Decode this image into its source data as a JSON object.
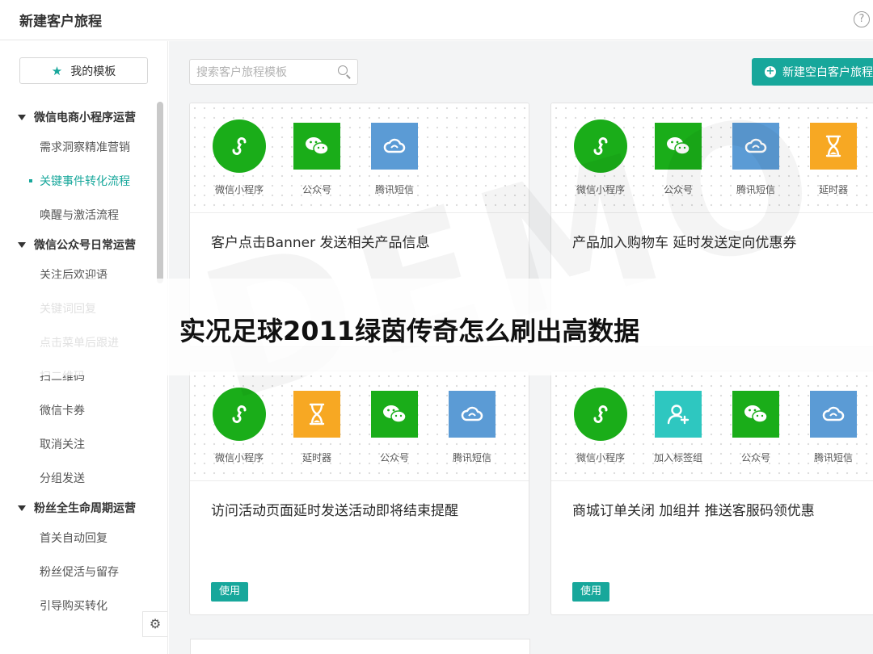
{
  "header": {
    "title": "新建客户旅程",
    "help_glyph": "?"
  },
  "sidebar": {
    "favorite_label": "我的模板",
    "settings_glyph": "⚙",
    "groups": [
      {
        "label": "微信电商小程序运营",
        "items": [
          "需求洞察精准营销",
          "关键事件转化流程",
          "唤醒与激活流程"
        ]
      },
      {
        "label": "微信公众号日常运营",
        "items": [
          "关注后欢迎语",
          "关键词回复",
          "点击菜单后跟进",
          "扫二维码",
          "微信卡券",
          "取消关注",
          "分组发送"
        ]
      },
      {
        "label": "粉丝全生命周期运营",
        "items": [
          "首关自动回复",
          "粉丝促活与留存",
          "引导购买转化"
        ]
      }
    ],
    "active_item": "关键事件转化流程"
  },
  "main": {
    "search_placeholder": "搜索客户旅程模板",
    "new_button_label": "新建空白客户旅程",
    "cards": [
      {
        "title": "客户点击Banner 发送相关产品信息",
        "use_label": "",
        "nodes": [
          {
            "label": "微信小程序",
            "icon": "mini-program-icon",
            "color": "#1aad19"
          },
          {
            "label": "公众号",
            "icon": "wechat-icon",
            "color": "#1aad19"
          },
          {
            "label": "腾讯短信",
            "icon": "cloud-sms-icon",
            "color": "#5b9bd5"
          }
        ]
      },
      {
        "title": "产品加入购物车 延时发送定向优惠券",
        "use_label": "",
        "nodes": [
          {
            "label": "微信小程序",
            "icon": "mini-program-icon",
            "color": "#1aad19"
          },
          {
            "label": "公众号",
            "icon": "wechat-icon",
            "color": "#1aad19"
          },
          {
            "label": "腾讯短信",
            "icon": "cloud-sms-icon",
            "color": "#5b9bd5"
          },
          {
            "label": "延时器",
            "icon": "hourglass-icon",
            "color": "#f7a823"
          }
        ]
      },
      {
        "title": "访问活动页面延时发送活动即将结束提醒",
        "use_label": "使用",
        "nodes": [
          {
            "label": "微信小程序",
            "icon": "mini-program-icon",
            "color": "#1aad19"
          },
          {
            "label": "延时器",
            "icon": "hourglass-icon",
            "color": "#f7a823"
          },
          {
            "label": "公众号",
            "icon": "wechat-icon",
            "color": "#1aad19"
          },
          {
            "label": "腾讯短信",
            "icon": "cloud-sms-icon",
            "color": "#5b9bd5"
          }
        ]
      },
      {
        "title": "商城订单关闭 加组并 推送客服码领优惠",
        "use_label": "使用",
        "nodes": [
          {
            "label": "微信小程序",
            "icon": "mini-program-icon",
            "color": "#1aad19"
          },
          {
            "label": "加入标签组",
            "icon": "add-user-icon",
            "color": "#2ec7c0"
          },
          {
            "label": "公众号",
            "icon": "wechat-icon",
            "color": "#1aad19"
          },
          {
            "label": "腾讯短信",
            "icon": "cloud-sms-icon",
            "color": "#5b9bd5"
          }
        ]
      }
    ]
  },
  "overlay": {
    "watermark": "DEMO",
    "banner_text": "实况足球2011绿茵传奇怎么刷出高数据"
  },
  "colors": {
    "accent": "#17a79b",
    "wechat_green": "#1aad19",
    "sms_blue": "#5b9bd5",
    "delay_orange": "#f7a823",
    "tag_teal": "#2ec7c0"
  }
}
